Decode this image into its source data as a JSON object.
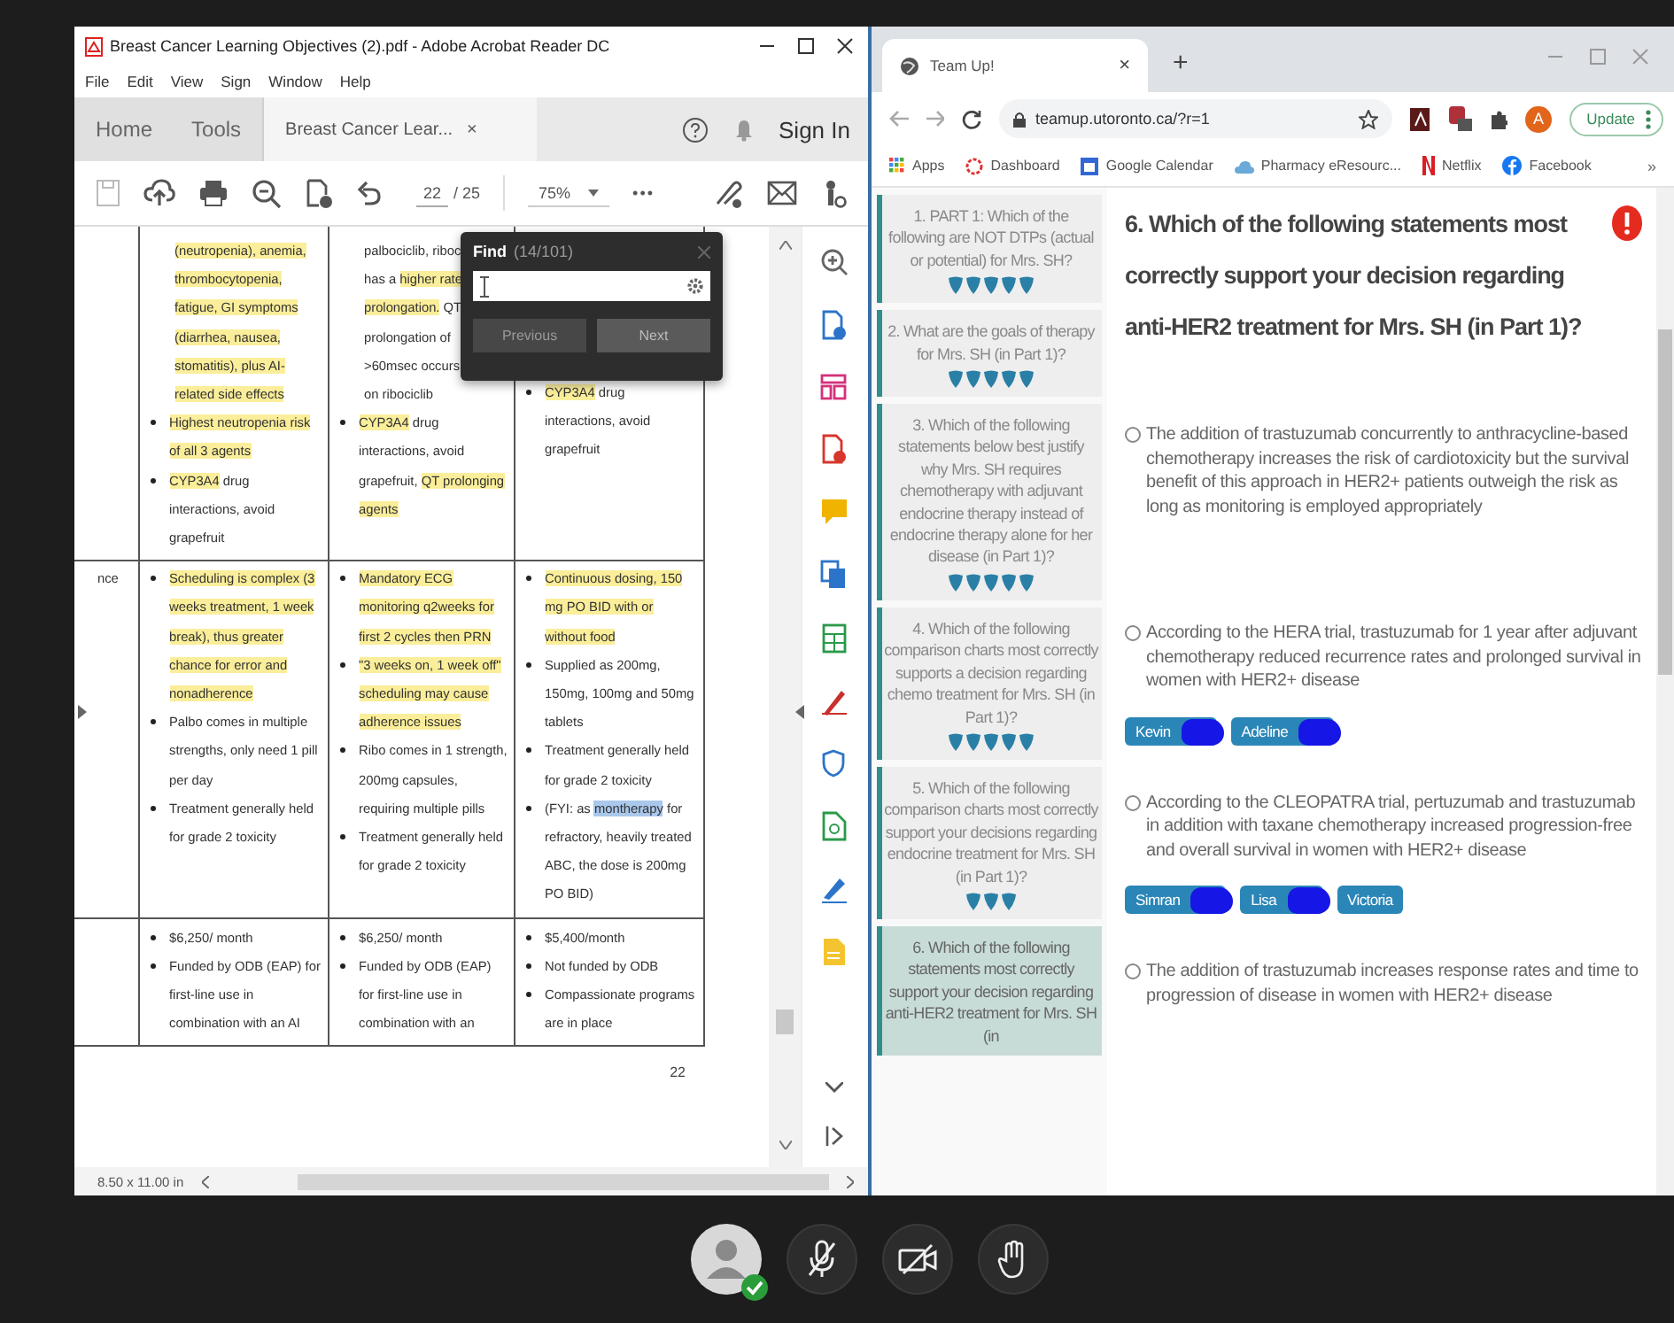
{
  "acrobat": {
    "title": "Breast Cancer Learning Objectives (2).pdf - Adobe Acrobat Reader DC",
    "menu": [
      "File",
      "Edit",
      "View",
      "Sign",
      "Window",
      "Help"
    ],
    "nav_tabs": [
      {
        "label": "Home",
        "selected": false
      },
      {
        "label": "Tools",
        "selected": false
      }
    ],
    "doc_tab": {
      "label": "Breast Cancer Lear...",
      "close": "×",
      "selected": true
    },
    "sign_in": "Sign In",
    "page_current": "22",
    "page_total": "/ 25",
    "zoom": "75%",
    "more": "•••",
    "find": {
      "title": "Find",
      "count": "(14/101)",
      "buttons": [
        {
          "label": "Previous",
          "disabled": true
        },
        {
          "label": "Next",
          "disabled": false
        }
      ]
    },
    "table": {
      "rows": [
        {
          "label": "",
          "cells": [
            [
              {
                "bullet": false,
                "parts": [
                  {
                    "text": "(neutropenia), anemia, thrombocytopenia, fatigue, GI symptoms (diarrhea, nausea, stomatitis), plus AI-related side effects",
                    "highlighted": true
                  }
                ]
              },
              {
                "bullet": true,
                "parts": [
                  {
                    "text": "Highest neutropenia risk of all 3 agents",
                    "highlighted": true
                  }
                ]
              },
              {
                "bullet": true,
                "parts": [
                  {
                    "text": "CYP3A4",
                    "highlighted": true
                  },
                  {
                    "text": " drug interactions, avoid grapefruit",
                    "highlighted": false
                  }
                ]
              }
            ],
            [
              {
                "bullet": false,
                "lines": [
                  [
                    {
                      "text": "palbociclib, riboc",
                      "highlighted": false
                    }
                  ],
                  [
                    {
                      "text": "has a ",
                      "highlighted": false
                    },
                    {
                      "text": "higher rate",
                      "highlighted": true
                    }
                  ],
                  [
                    {
                      "text": "prolongation.",
                      "highlighted": true
                    },
                    {
                      "text": " QT",
                      "highlighted": false
                    }
                  ],
                  [
                    {
                      "text": "prolongation of",
                      "highlighted": false
                    }
                  ],
                  [
                    {
                      "text": ">60msec occurs",
                      "highlighted": false
                    }
                  ],
                  [
                    {
                      "text": "on ribociclib",
                      "highlighted": false
                    }
                  ]
                ]
              },
              {
                "bullet": true,
                "parts": [
                  {
                    "text": "CYP3A4",
                    "highlighted": true
                  },
                  {
                    "text": " drug interactions, avoid grapefruit, ",
                    "highlighted": false
                  },
                  {
                    "text": "QT prolonging agents",
                    "highlighted": true
                  }
                ]
              }
            ],
            [
              {
                "bullet": true,
                "parts": [
                  {
                    "text": "CYP3A4",
                    "highlighted": true
                  },
                  {
                    "text": " drug interactions, avoid grapefruit",
                    "highlighted": false
                  }
                ]
              }
            ]
          ]
        },
        {
          "label": "nce",
          "cells": [
            [
              {
                "bullet": true,
                "parts": [
                  {
                    "text": "Scheduling is complex (3 weeks treatment, 1 week break), thus greater chance for error and nonadherence",
                    "highlighted": true
                  }
                ]
              },
              {
                "bullet": true,
                "parts": [
                  {
                    "text": "Palbo comes in multiple strengths, only need 1 pill per day",
                    "highlighted": false
                  }
                ]
              },
              {
                "bullet": true,
                "parts": [
                  {
                    "text": "Treatment generally held for grade 2 toxicity",
                    "highlighted": false
                  }
                ]
              }
            ],
            [
              {
                "bullet": true,
                "parts": [
                  {
                    "text": "Mandatory ECG monitoring q2weeks for first 2 cycles then PRN",
                    "highlighted": true
                  }
                ]
              },
              {
                "bullet": true,
                "parts": [
                  {
                    "text": "\"3 weeks on, 1 week off\" scheduling may cause adherence issues",
                    "highlighted": true
                  }
                ]
              },
              {
                "bullet": true,
                "parts": [
                  {
                    "text": "Ribo comes in 1 strength, 200mg capsules, requiring multiple pills",
                    "highlighted": false
                  }
                ]
              },
              {
                "bullet": true,
                "parts": [
                  {
                    "text": "Treatment generally held for grade 2 toxicity",
                    "highlighted": false
                  }
                ]
              }
            ],
            [
              {
                "bullet": true,
                "parts": [
                  {
                    "text": "Continuous dosing, 150 mg PO BID with or without food",
                    "highlighted": true
                  }
                ]
              },
              {
                "bullet": true,
                "parts": [
                  {
                    "text": "Supplied as 200mg, 150mg, 100mg and 50mg tablets",
                    "highlighted": false
                  }
                ]
              },
              {
                "bullet": true,
                "parts": [
                  {
                    "text": "Treatment generally held for grade 2 toxicity",
                    "highlighted": false
                  }
                ]
              },
              {
                "bullet": true,
                "parts": [
                  {
                    "text": "(FYI: as ",
                    "highlighted": false,
                    "selected": false
                  },
                  {
                    "text": "montherapy",
                    "highlighted": false,
                    "selected": true
                  },
                  {
                    "text": " for refractory, heavily treated ABC, the dose is 200mg PO BID)",
                    "highlighted": false,
                    "selected": false
                  }
                ]
              }
            ]
          ]
        },
        {
          "label": "",
          "cells": [
            [
              {
                "bullet": true,
                "parts": [
                  {
                    "text": "$6,250/ month",
                    "highlighted": false
                  }
                ]
              },
              {
                "bullet": true,
                "parts": [
                  {
                    "text": "Funded by ODB (EAP) for first-line use in combination with an AI",
                    "highlighted": false
                  }
                ]
              }
            ],
            [
              {
                "bullet": true,
                "parts": [
                  {
                    "text": "$6,250/ month",
                    "highlighted": false
                  }
                ]
              },
              {
                "bullet": true,
                "parts": [
                  {
                    "text": "Funded by ODB (EAP) for first-line use in combination with an",
                    "highlighted": false
                  }
                ]
              }
            ],
            [
              {
                "bullet": true,
                "parts": [
                  {
                    "text": "$5,400/month",
                    "highlighted": false
                  }
                ]
              },
              {
                "bullet": true,
                "parts": [
                  {
                    "text": "Not funded by ODB",
                    "highlighted": false
                  }
                ]
              },
              {
                "bullet": true,
                "parts": [
                  {
                    "text": "Compassionate programs are in place",
                    "highlighted": false
                  }
                ]
              }
            ]
          ]
        }
      ]
    },
    "page_number": "22",
    "page_size": "8.50 x 11.00 in"
  },
  "browser": {
    "tab": {
      "title": "Team Up!",
      "close": "×"
    },
    "new_tab": "+",
    "url": "teamup.utoronto.ca/?r=1",
    "profile_initial": "A",
    "update": "Update",
    "bookmarks": [
      {
        "label": "Apps",
        "kind": "apps"
      },
      {
        "label": "Dashboard",
        "kind": "ring"
      },
      {
        "label": "Google Calendar",
        "kind": "calendar"
      },
      {
        "label": "Pharmacy eResourc...",
        "kind": "cloud"
      },
      {
        "label": "Netflix",
        "kind": "netflix"
      },
      {
        "label": "Facebook",
        "kind": "facebook"
      }
    ],
    "bookmarks_more": "»",
    "questions": [
      {
        "text": "1. PART 1: Which of the following are NOT DTPs (actual or potential) for Mrs. SH?",
        "stars": 5,
        "selected": false
      },
      {
        "text": "2. What are the goals of therapy for Mrs. SH (in Part 1)?",
        "stars": 5,
        "selected": false
      },
      {
        "text": "3. Which of the following statements below best justify why Mrs. SH requires chemotherapy with adjuvant endocrine therapy instead of endocrine therapy alone for her disease (in Part 1)?",
        "stars": 5,
        "selected": false
      },
      {
        "text": "4. Which of the following comparison charts most correctly supports a decision regarding chemo treatment for Mrs. SH (in Part 1)?",
        "stars": 5,
        "selected": false
      },
      {
        "text": "5. Which of the following comparison charts most correctly support your decisions regarding endocrine treatment for Mrs. SH (in Part 1)?",
        "stars": 3,
        "selected": false
      },
      {
        "text": "6. Which of the following statements most correctly support your decision regarding anti-HER2 treatment for Mrs. SH (in",
        "selected": true
      }
    ],
    "question_title": "6. Which of the following statements most correctly support your decision regarding anti-HER2 treatment for Mrs. SH (in Part 1)?",
    "options": [
      {
        "text": "The addition of trastuzumab concurrently to anthracycline-based chemotherapy increases the risk of cardiotoxicity but the survival benefit of this approach in HER2+ patients outweigh the risk as long as monitoring is employed appropriately",
        "selected": false
      },
      {
        "text": "According to the HERA trial, trastuzumab for 1 year after adjuvant chemotherapy reduced recurrence rates and prolonged survival in women with HER2+ disease",
        "selected": false,
        "tags": [
          {
            "label": "Kevin",
            "redacted": true
          },
          {
            "label": "Adeline",
            "redacted": true
          }
        ]
      },
      {
        "text": "According to the CLEOPATRA trial, pertuzumab and trastuzumab in addition with taxane chemotherapy increased progression-free and overall survival in women with HER2+ disease",
        "selected": false,
        "tags": [
          {
            "label": "Simran",
            "redacted": true
          },
          {
            "label": "Lisa",
            "redacted": true
          },
          {
            "label": "Victoria",
            "redacted": false
          }
        ]
      },
      {
        "text": "The addition of trastuzumab increases response rates and time to progression of disease in women with HER2+ disease",
        "selected": false
      }
    ]
  },
  "call": {
    "mic_on": false,
    "camera_on": false
  }
}
